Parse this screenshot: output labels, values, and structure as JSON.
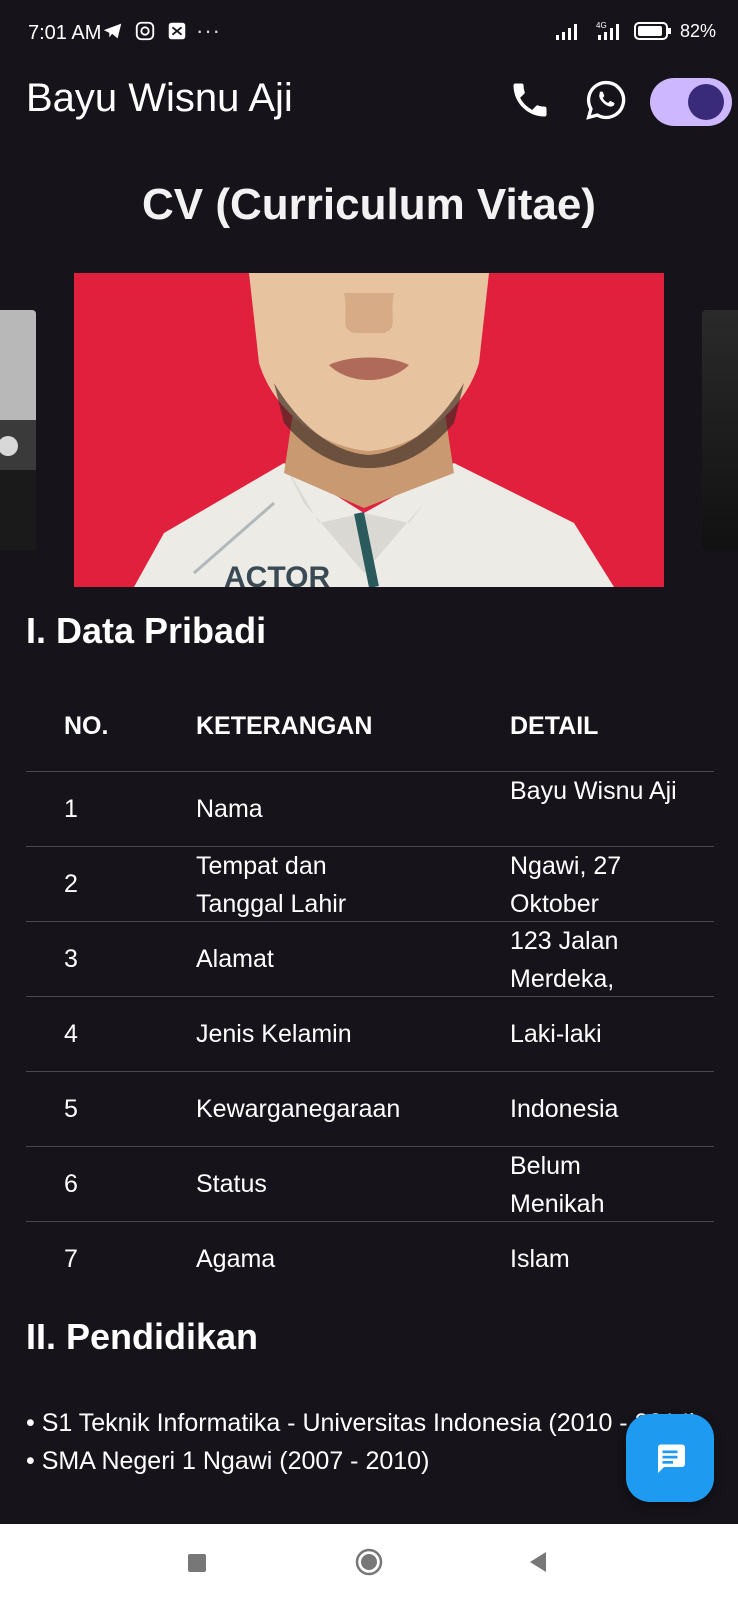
{
  "status_bar": {
    "time": "7:01 AM",
    "more": "···",
    "network": "4G",
    "battery": "82%"
  },
  "app_bar": {
    "title": "Bayu Wisnu Aji",
    "icons": [
      "phone-icon",
      "whatsapp-icon"
    ],
    "toggle_on": true
  },
  "cv": {
    "title": "CV (Curriculum Vitae)"
  },
  "personal": {
    "heading": "I. Data Pribadi",
    "columns": [
      "NO.",
      "KETERANGAN",
      "DETAIL"
    ],
    "rows": [
      {
        "no": "1",
        "ket": "Nama",
        "det": "Bayu Wisnu Aji"
      },
      {
        "no": "2",
        "ket": "Tempat dan Tanggal Lahir",
        "det": "Ngawi, 27 Oktober"
      },
      {
        "no": "3",
        "ket": "Alamat",
        "det": "123 Jalan Merdeka,"
      },
      {
        "no": "4",
        "ket": "Jenis Kelamin",
        "det": "Laki-laki"
      },
      {
        "no": "5",
        "ket": "Kewarganegaraan",
        "det": "Indonesia"
      },
      {
        "no": "6",
        "ket": "Status",
        "det": "Belum Menikah"
      },
      {
        "no": "7",
        "ket": "Agama",
        "det": "Islam"
      }
    ]
  },
  "education": {
    "heading": "II. Pendidikan",
    "items": [
      "• S1 Teknik Informatika - Universitas Indonesia (2010 - 2014)",
      "• SMA Negeri 1 Ngawi (2007 - 2010)"
    ]
  },
  "colors": {
    "background": "#16141a",
    "toggle_track": "#cdb8ff",
    "toggle_knob": "#3a2a7a",
    "fab": "#1e9bf0",
    "photo_bg": "#e0203c"
  }
}
